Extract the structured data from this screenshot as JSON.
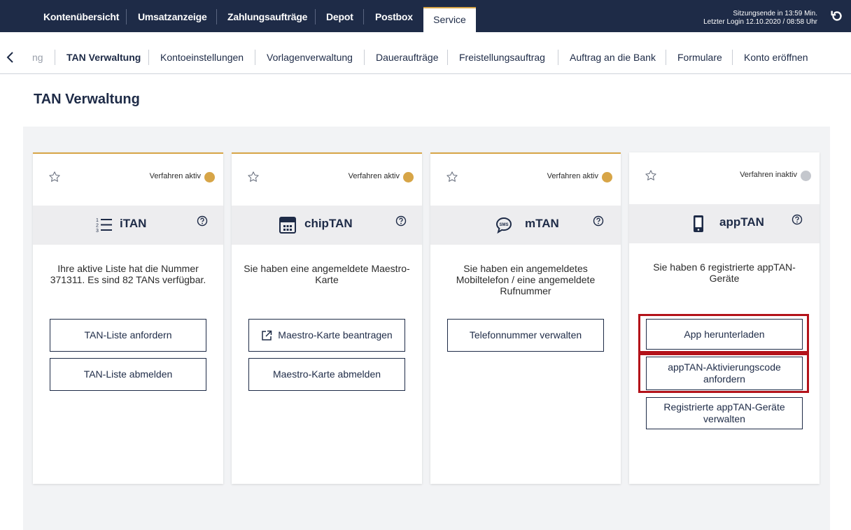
{
  "topnav": {
    "items": [
      "Kontenübersicht",
      "Umsatzanzeige",
      "Zahlungsaufträge",
      "Depot",
      "Postbox"
    ],
    "active": "Service",
    "session_end": "Sitzungsende in 13:59 Min.",
    "last_login": "Letzter Login 12.10.2020 / 08:58 Uhr"
  },
  "subnav": {
    "items": [
      "ng",
      "TAN Verwaltung",
      "Kontoeinstellungen",
      "Vorlagenverwaltung",
      "Daueraufträge",
      "Freistellungsauftrag",
      "Auftrag an die Bank",
      "Formulare",
      "Konto eröffnen"
    ]
  },
  "page_title": "TAN Verwaltung",
  "cards": [
    {
      "status": "Verfahren aktiv",
      "status_color": "#d7a547",
      "name": "iTAN",
      "icon": "numbered-list-icon",
      "description": "Ihre aktive Liste hat die Nummer 371311. Es sind 82 TANs verfügbar.",
      "buttons": [
        "TAN-Liste anfordern",
        "TAN-Liste abmelden"
      ]
    },
    {
      "status": "Verfahren aktiv",
      "status_color": "#d7a547",
      "name": "chipTAN",
      "icon": "calculator-icon",
      "description": "Sie haben eine angemeldete Maestro-Karte",
      "buttons": [
        "Maestro-Karte beantragen",
        "Maestro-Karte abmelden"
      ]
    },
    {
      "status": "Verfahren aktiv",
      "status_color": "#d7a547",
      "name": "mTAN",
      "icon": "sms-bubble-icon",
      "description": "Sie haben ein angemeldetes Mobiltelefon / eine angemeldete Rufnummer",
      "buttons": [
        "Telefonnummer verwalten"
      ]
    },
    {
      "status": "Verfahren inaktiv",
      "status_color": "#c4c7cd",
      "name": "appTAN",
      "icon": "smartphone-icon",
      "description": "Sie haben 6 registrierte appTAN-Geräte",
      "buttons": [
        "App herunterladen",
        "appTAN-Aktivierungscode anfordern",
        "Registrierte appTAN-Geräte verwalten"
      ]
    }
  ],
  "colors": {
    "nav_bg": "#1e2b47",
    "accent": "#d7a547",
    "highlight": "#b3121a"
  }
}
